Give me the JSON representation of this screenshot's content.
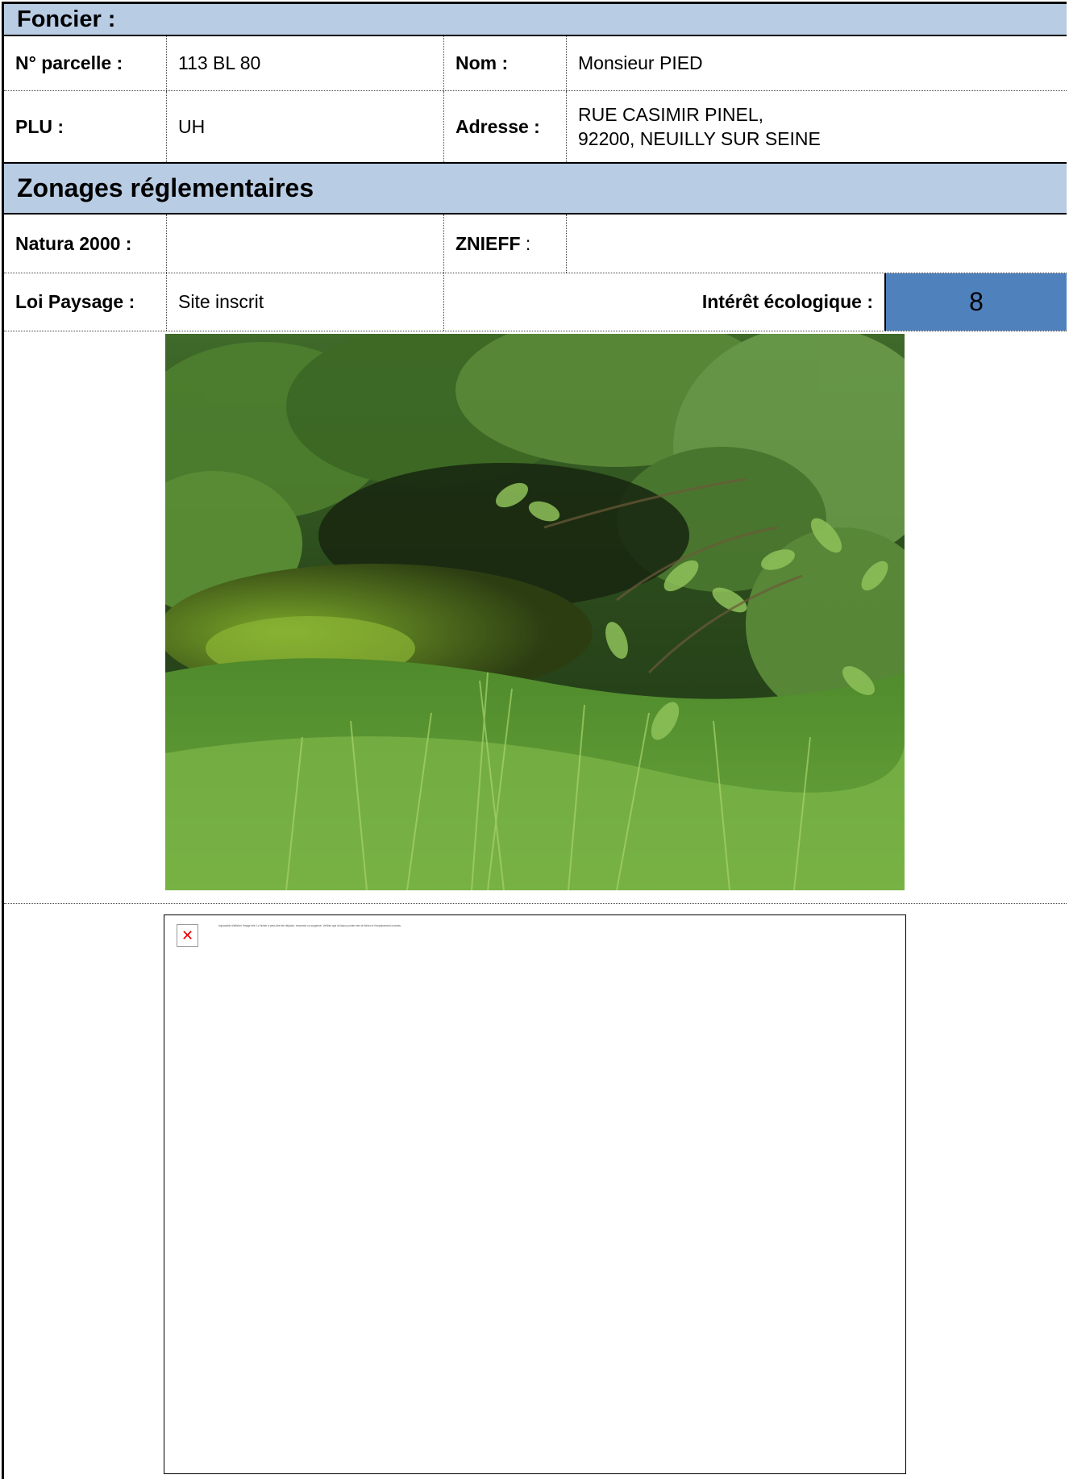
{
  "foncier": {
    "title": "Foncier :",
    "parcelle_label": "N° parcelle :",
    "parcelle_value": "113 BL 80",
    "nom_label": "Nom :",
    "nom_value": "Monsieur PIED",
    "plu_label": "PLU :",
    "plu_value": "UH",
    "adresse_label": "Adresse :",
    "adresse_line1": "RUE CASIMIR PINEL,",
    "adresse_line2": "92200, NEUILLY SUR SEINE"
  },
  "zonages": {
    "title": "Zonages réglementaires",
    "natura_label": "Natura 2000 :",
    "natura_value": "",
    "znieff_label": "ZNIEFF",
    "znieff_colon": " :",
    "znieff_value": "",
    "loi_label": "Loi Paysage :",
    "loi_value": "Site inscrit",
    "interet_label": "Intérêt écologique :",
    "interet_value": "8"
  },
  "colors": {
    "header_bg": "#b8cce4",
    "score_bg": "#4f81bd",
    "error_x": "#e00000"
  },
  "broken_image": {
    "message": "Impossible d'afficher l'image liée. Le fichier a peut-être été déplacé, renommé ou supprimé. Vérifiez que la liaison pointe vers le fichier et l'emplacement corrects."
  }
}
